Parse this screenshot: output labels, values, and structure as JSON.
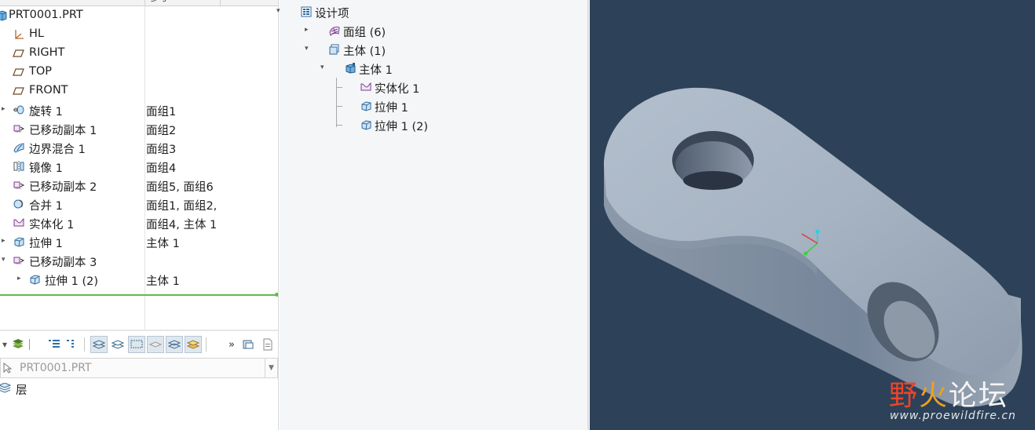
{
  "model_tree": {
    "header_col2": "参考",
    "items": [
      {
        "label": "PRT0001.PRT",
        "col2": "",
        "icon": "part-icon",
        "indent": 0,
        "arrow": ""
      },
      {
        "label": "HL",
        "col2": "",
        "icon": "csys-icon",
        "indent": 1,
        "arrow": ""
      },
      {
        "label": "RIGHT",
        "col2": "",
        "icon": "datum-plane-icon",
        "indent": 1,
        "arrow": ""
      },
      {
        "label": "TOP",
        "col2": "",
        "icon": "datum-plane-icon",
        "indent": 1,
        "arrow": ""
      },
      {
        "label": "FRONT",
        "col2": "",
        "icon": "datum-plane-icon",
        "indent": 1,
        "arrow": ""
      },
      {
        "label": "旋转 1",
        "col2": "面组1",
        "icon": "revolve-icon",
        "indent": 1,
        "arrow": "right"
      },
      {
        "label": "已移动副本 1",
        "col2": "面组2",
        "icon": "moved-copy-icon",
        "indent": 1,
        "arrow": ""
      },
      {
        "label": "边界混合 1",
        "col2": "面组3",
        "icon": "boundary-blend-icon",
        "indent": 1,
        "arrow": ""
      },
      {
        "label": "镜像 1",
        "col2": "面组4",
        "icon": "mirror-icon",
        "indent": 1,
        "arrow": ""
      },
      {
        "label": "已移动副本 2",
        "col2": "面组5, 面组6",
        "icon": "moved-copy-icon",
        "indent": 1,
        "arrow": ""
      },
      {
        "label": "合并 1",
        "col2": "面组1, 面组2,",
        "icon": "merge-icon",
        "indent": 1,
        "arrow": ""
      },
      {
        "label": "实体化 1",
        "col2": "面组4, 主体 1",
        "icon": "solidify-icon",
        "indent": 1,
        "arrow": ""
      },
      {
        "label": "拉伸 1",
        "col2": "主体 1",
        "icon": "extrude-icon",
        "indent": 1,
        "arrow": "right"
      },
      {
        "label": "已移动副本 3",
        "col2": "",
        "icon": "moved-copy-icon",
        "indent": 1,
        "arrow": "down"
      },
      {
        "label": "拉伸 1 (2)",
        "col2": "主体 1",
        "icon": "extrude-icon",
        "indent": 2,
        "arrow": "right"
      }
    ]
  },
  "layer_panel": {
    "model_select_value": "PRT0001.PRT",
    "layer_label": "层"
  },
  "design_items": {
    "items": [
      {
        "label": "设计项",
        "icon": "design-items-icon",
        "arrow": "down"
      },
      {
        "label": "面组 (6)",
        "icon": "quilt-icon",
        "arrow": "right"
      },
      {
        "label": "主体 (1)",
        "icon": "bodies-icon",
        "arrow": "down"
      },
      {
        "label": "主体 1",
        "icon": "body-icon",
        "arrow": "down"
      },
      {
        "label": "实体化 1",
        "icon": "solidify-icon",
        "arrow": ""
      },
      {
        "label": "拉伸 1",
        "icon": "extrude-icon",
        "arrow": ""
      },
      {
        "label": "拉伸 1 (2)",
        "icon": "extrude-icon",
        "arrow": ""
      }
    ]
  },
  "watermark": {
    "part1": "野",
    "part2": "火",
    "part3": "论坛",
    "url": "www.proewildfire.cn"
  },
  "colors": {
    "viewport_bg": "#2d4158",
    "insert_line": "#5dbb4a",
    "watermark_red": "#e8462a",
    "watermark_orange": "#f0a020"
  }
}
